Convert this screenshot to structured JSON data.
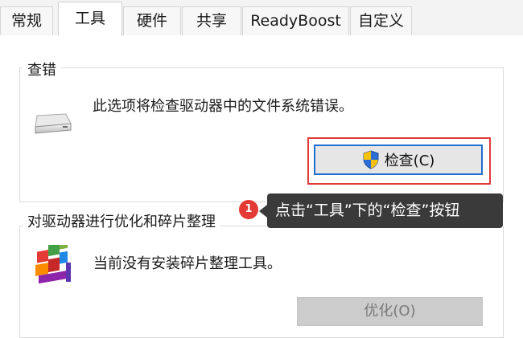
{
  "tabs": [
    {
      "label": "常规"
    },
    {
      "label": "工具",
      "active": true
    },
    {
      "label": "硬件"
    },
    {
      "label": "共享"
    },
    {
      "label": "ReadyBoost"
    },
    {
      "label": "自定义"
    }
  ],
  "error_check": {
    "group_title": "查错",
    "description": "此选项将检查驱动器中的文件系统错误。",
    "check_button_label": "检查(C)",
    "icons": {
      "drive": "drive-icon",
      "shield": "uac-shield-icon"
    }
  },
  "optimize": {
    "group_title": "对驱动器进行优化和碎片整理",
    "description": "当前没有安装碎片整理工具。",
    "optimize_button_label": "优化(O)",
    "icons": {
      "defrag": "defrag-icon"
    }
  },
  "annotation": {
    "badge_number": "1",
    "text": "点击“工具”下的“检查”按钮"
  },
  "colors": {
    "highlight_box": "#e03a3a",
    "focus_border": "#1f6fd1",
    "callout_bg": "#3a3a3a",
    "badge_bg": "#e53935"
  }
}
